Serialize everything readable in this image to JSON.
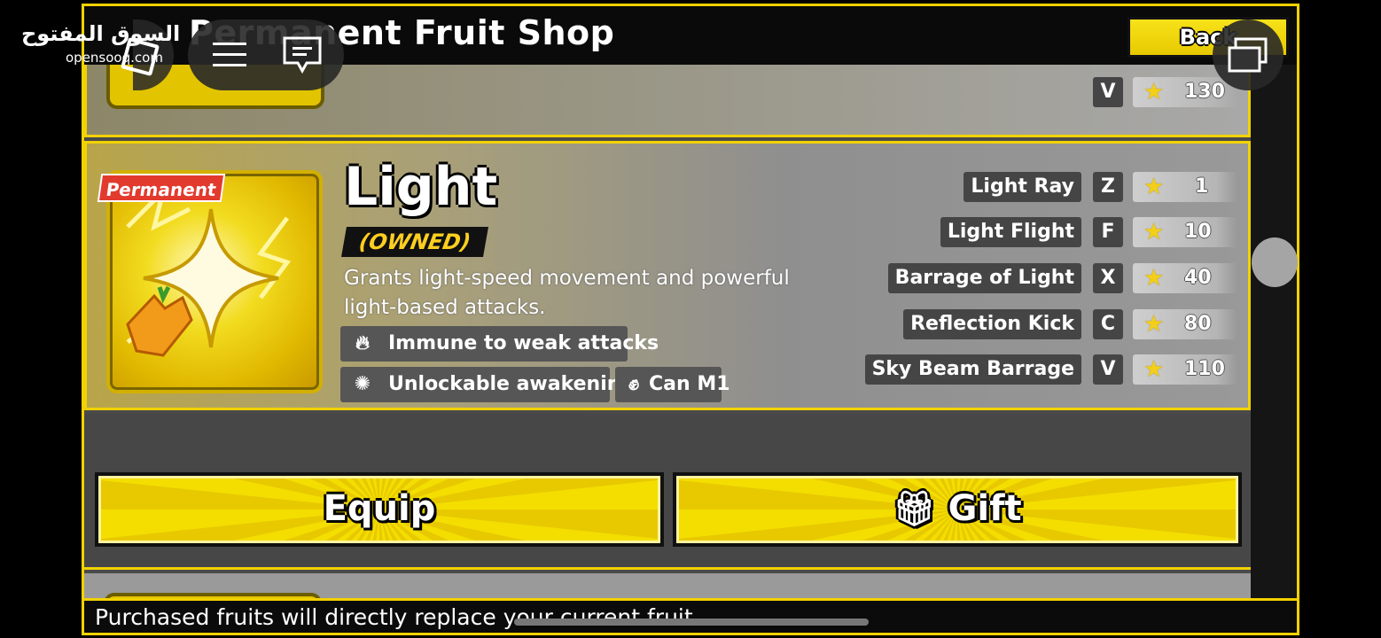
{
  "title": "Permanent Fruit Shop",
  "back_label": "Back",
  "watermark": {
    "arabic": "السوق المفتوح",
    "latin": "opensooq.com"
  },
  "previous_item": {
    "key": "V",
    "cost": "130"
  },
  "fruit": {
    "badge": "Permanent",
    "name": "Light",
    "status": "(OWNED)",
    "description": "Grants light-speed movement and powerful light-based attacks.",
    "tags": [
      {
        "label": "Immune to weak attacks",
        "icon": "fire-icon"
      },
      {
        "label": "Unlockable awakening",
        "icon": "awakening-icon"
      },
      {
        "label": "Can M1",
        "icon": "fist-icon"
      }
    ],
    "moves": [
      {
        "name": "Light Ray",
        "key": "Z",
        "cost": "1"
      },
      {
        "name": "Light Flight",
        "key": "F",
        "cost": "10"
      },
      {
        "name": "Barrage of Light",
        "key": "X",
        "cost": "40"
      },
      {
        "name": "Reflection Kick",
        "key": "C",
        "cost": "80"
      },
      {
        "name": "Sky Beam Barrage",
        "key": "V",
        "cost": "110"
      }
    ]
  },
  "buttons": {
    "equip": "Equip",
    "gift": "Gift"
  },
  "footer": "Purchased fruits will directly replace your current fruit",
  "colors": {
    "accent": "#f2d200",
    "badge": "#e23a2d",
    "owned_text": "#ffcf1f"
  }
}
